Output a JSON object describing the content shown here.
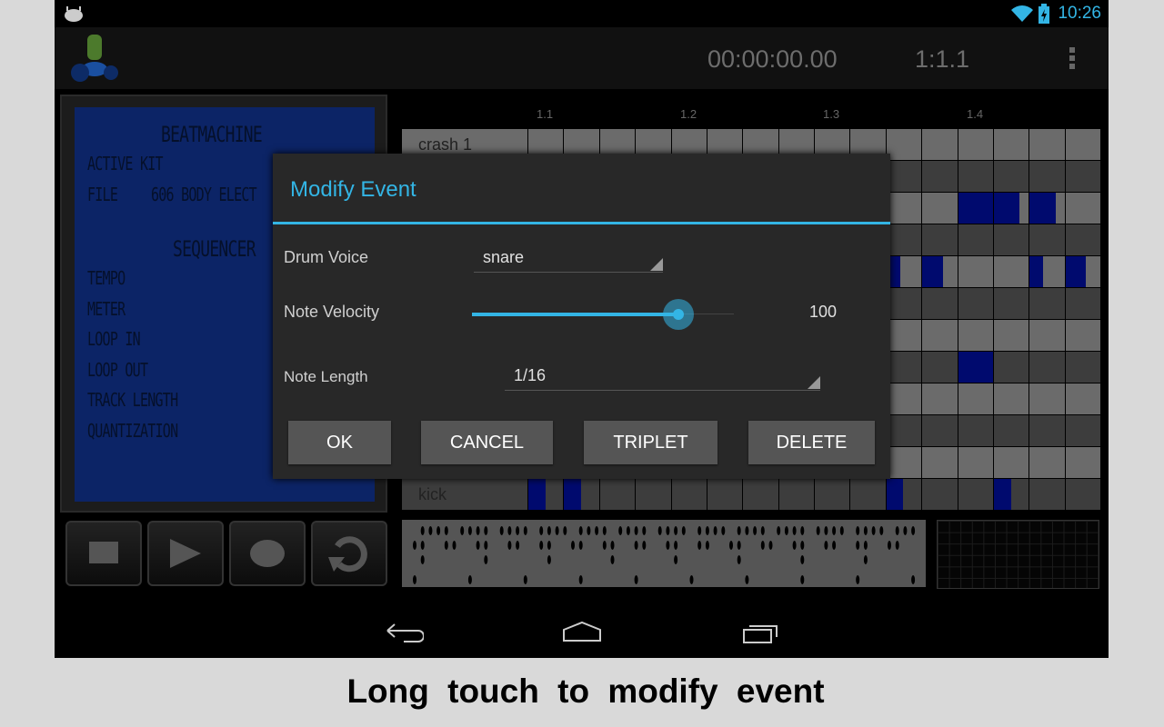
{
  "status_bar": {
    "time": "10:26",
    "icons": [
      "android-debug-icon",
      "wifi-icon",
      "battery-charging-icon"
    ]
  },
  "action_bar": {
    "app_icon": "drum-kit-android-icon",
    "clock": "00:00:00.00",
    "position": "1:1.1",
    "menu_icon": "overflow-menu-icon"
  },
  "lcd": {
    "title": "BEATMACHINE",
    "active_kit_label": "ACTIVE KIT",
    "file_label": "FILE",
    "file_value": "606 BODY ELECT",
    "sequencer_title": "SEQUENCER",
    "fields": [
      "TEMPO",
      "METER",
      "LOOP IN",
      "LOOP OUT",
      "TRACK LENGTH",
      "QUANTIZATION"
    ]
  },
  "transport": [
    {
      "name": "stop",
      "icon": "stop-icon"
    },
    {
      "name": "play",
      "icon": "play-icon"
    },
    {
      "name": "record",
      "icon": "record-icon"
    },
    {
      "name": "loop",
      "icon": "loop-icon"
    }
  ],
  "sequencer": {
    "ruler": [
      "1.1",
      "1.2",
      "1.3",
      "1.4"
    ],
    "steps": 16,
    "tracks": [
      "crash 1",
      "",
      "",
      "",
      "",
      "",
      "",
      "",
      "",
      "",
      "",
      "kick"
    ],
    "events": [
      {
        "track": 2,
        "step": 12,
        "length": 1
      },
      {
        "track": 2,
        "step": 13,
        "length": 0.75
      },
      {
        "track": 2,
        "step": 14,
        "length": 0.75
      },
      {
        "track": 4,
        "step": 10,
        "length": 0.4
      },
      {
        "track": 4,
        "step": 11,
        "length": 0.6
      },
      {
        "track": 4,
        "step": 14,
        "length": 0.4
      },
      {
        "track": 4,
        "step": 15,
        "length": 0.6
      },
      {
        "track": 7,
        "step": 12,
        "length": 1
      },
      {
        "track": 11,
        "step": 0,
        "length": 0.5
      },
      {
        "track": 11,
        "step": 1,
        "length": 0.5
      },
      {
        "track": 11,
        "step": 10,
        "length": 0.5
      },
      {
        "track": 11,
        "step": 13,
        "length": 0.5
      }
    ],
    "colors": {
      "light_row": "#6b6b6b",
      "dark_row": "#3d3d3d",
      "event": "#000a6e"
    }
  },
  "dialog": {
    "title": "Modify Event",
    "drum_voice_label": "Drum Voice",
    "drum_voice_value": "snare",
    "velocity_label": "Note Velocity",
    "velocity_value": 100,
    "velocity_max": 127,
    "length_label": "Note Length",
    "length_value": "1/16",
    "buttons": {
      "ok": "OK",
      "cancel": "CANCEL",
      "triplet": "TRIPLET",
      "delete": "DELETE"
    },
    "accent": "#33b5e5"
  },
  "nav_bar": {
    "icons": [
      "back-icon",
      "home-icon",
      "recent-apps-icon"
    ]
  },
  "caption": "Long touch to modify event"
}
